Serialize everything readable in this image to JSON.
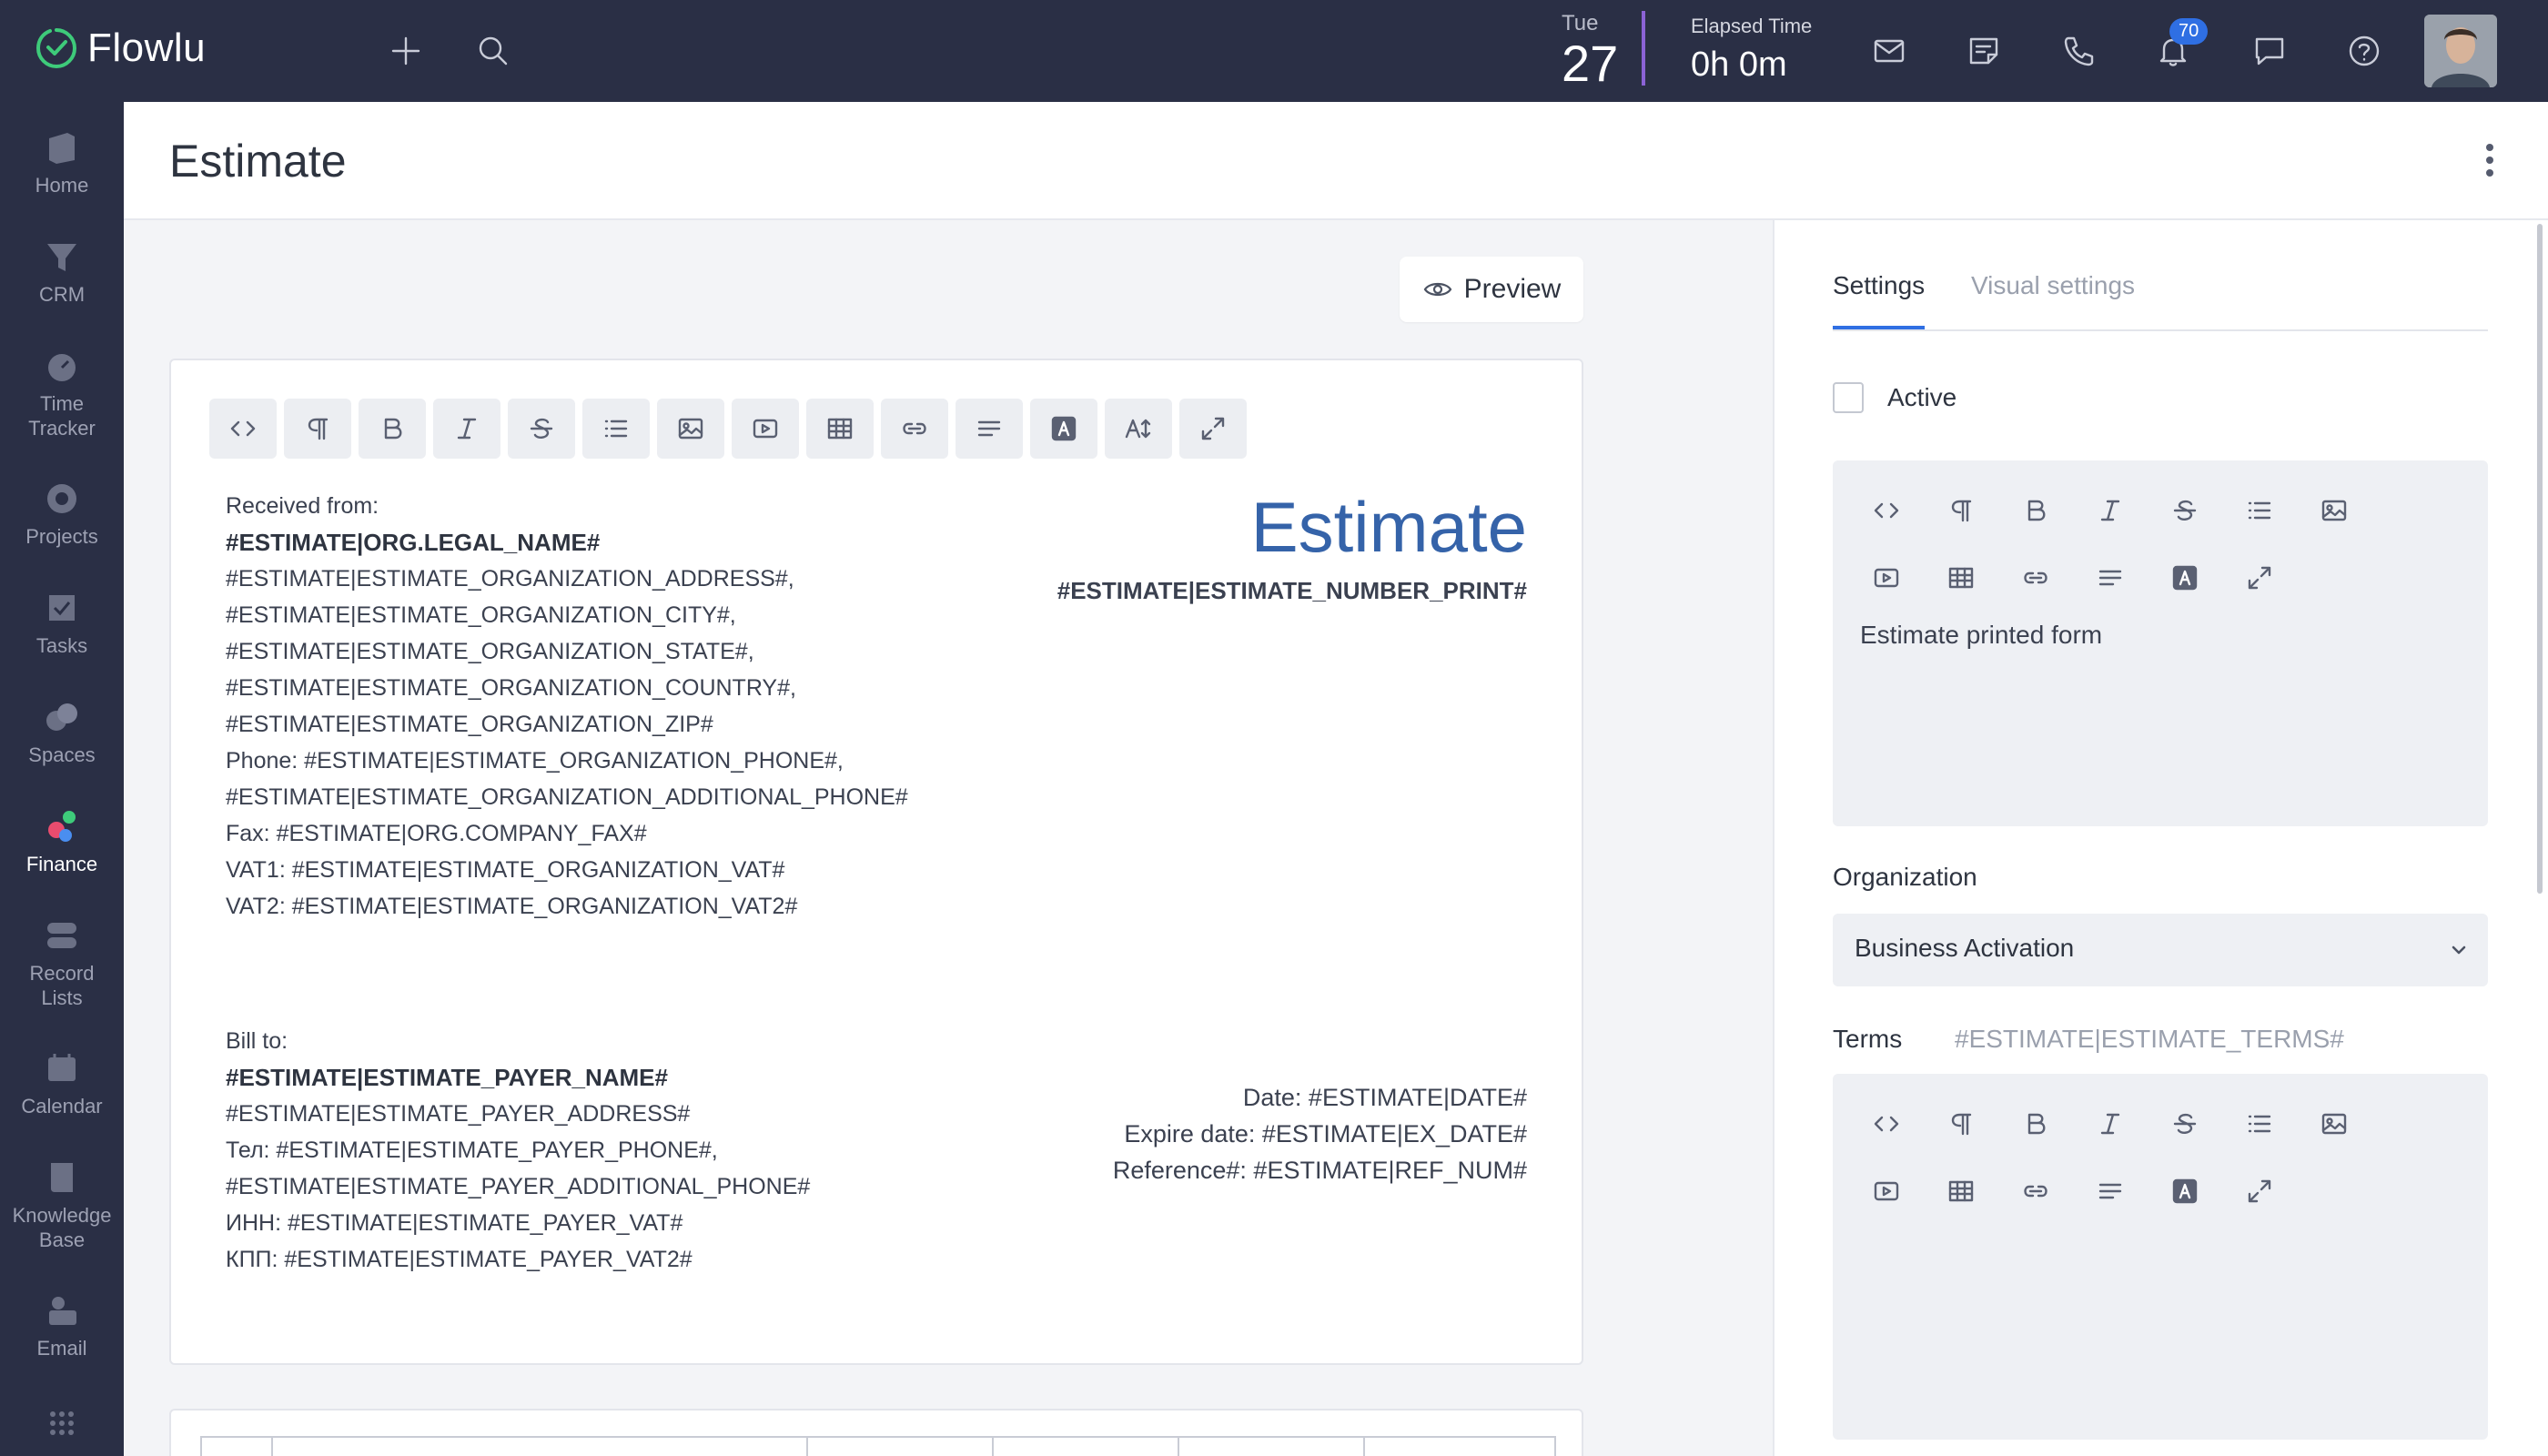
{
  "app": {
    "name": "Flowlu"
  },
  "topbar": {
    "day_name": "Tue",
    "day_number": "27",
    "elapsed_label": "Elapsed Time",
    "elapsed_value": "0h 0m",
    "notifications_count": "70"
  },
  "sidebar": {
    "items": [
      {
        "label_line1": "Home",
        "label_line2": ""
      },
      {
        "label_line1": "CRM",
        "label_line2": ""
      },
      {
        "label_line1": "Time",
        "label_line2": "Tracker"
      },
      {
        "label_line1": "Projects",
        "label_line2": ""
      },
      {
        "label_line1": "Tasks",
        "label_line2": ""
      },
      {
        "label_line1": "Spaces",
        "label_line2": ""
      },
      {
        "label_line1": "Finance",
        "label_line2": ""
      },
      {
        "label_line1": "Record",
        "label_line2": "Lists"
      },
      {
        "label_line1": "Calendar",
        "label_line2": ""
      },
      {
        "label_line1": "Knowledge",
        "label_line2": "Base"
      },
      {
        "label_line1": "Email",
        "label_line2": ""
      }
    ],
    "active": "Finance"
  },
  "page": {
    "title": "Estimate"
  },
  "editor": {
    "preview_label": "Preview",
    "from_lines": [
      "Received from:",
      "#ESTIMATE|ORG.LEGAL_NAME#",
      "#ESTIMATE|ESTIMATE_ORGANIZATION_ADDRESS#,",
      "#ESTIMATE|ESTIMATE_ORGANIZATION_CITY#,",
      "#ESTIMATE|ESTIMATE_ORGANIZATION_STATE#,",
      "#ESTIMATE|ESTIMATE_ORGANIZATION_COUNTRY#,",
      "#ESTIMATE|ESTIMATE_ORGANIZATION_ZIP#",
      "Phone: #ESTIMATE|ESTIMATE_ORGANIZATION_PHONE#,",
      "#ESTIMATE|ESTIMATE_ORGANIZATION_ADDITIONAL_PHONE#",
      "Fax: #ESTIMATE|ORG.COMPANY_FAX#",
      "VAT1: #ESTIMATE|ESTIMATE_ORGANIZATION_VAT#",
      "VAT2: #ESTIMATE|ESTIMATE_ORGANIZATION_VAT2#"
    ],
    "doc_title": "Estimate",
    "doc_number": "#ESTIMATE|ESTIMATE_NUMBER_PRINT#",
    "bill_lines": [
      "Bill to:",
      "#ESTIMATE|ESTIMATE_PAYER_NAME#",
      "#ESTIMATE|ESTIMATE_PAYER_ADDRESS#",
      "Тел: #ESTIMATE|ESTIMATE_PAYER_PHONE#,",
      "#ESTIMATE|ESTIMATE_PAYER_ADDITIONAL_PHONE#",
      "ИНН: #ESTIMATE|ESTIMATE_PAYER_VAT#",
      "КПП: #ESTIMATE|ESTIMATE_PAYER_VAT2#"
    ],
    "date_lines": [
      "Date: #ESTIMATE|DATE#",
      "Expire date: #ESTIMATE|EX_DATE#",
      "Reference#: #ESTIMATE|REF_NUM#"
    ]
  },
  "settings": {
    "tabs": [
      "Settings",
      "Visual settings"
    ],
    "active_tab": "Settings",
    "active_label": "Active",
    "active_checked": false,
    "header_text": "Estimate printed form",
    "organization_label": "Organization",
    "organization_value": "Business Activation",
    "terms_label": "Terms",
    "terms_tag": "#ESTIMATE|ESTIMATE_TERMS#"
  },
  "colors": {
    "topbar_bg": "#2a2f45",
    "accent": "#2f6fe3",
    "doc_title": "#3563a9",
    "timer_divider": "#8b63d6"
  }
}
